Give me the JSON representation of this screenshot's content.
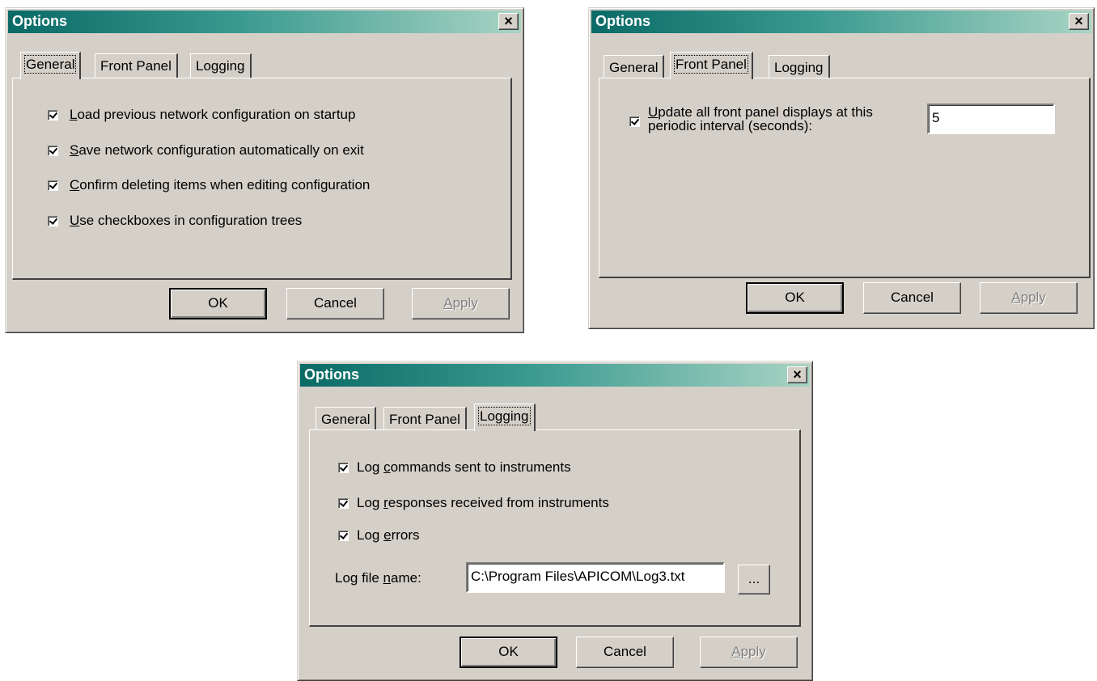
{
  "dialog1": {
    "title": "Options",
    "close": "×",
    "tabs": [
      "General",
      "Front Panel",
      "Logging"
    ],
    "checkboxes": [
      {
        "u": "L",
        "rest": "oad previous network configuration on startup"
      },
      {
        "u": "S",
        "rest": "ave network configuration automatically on exit"
      },
      {
        "u": "C",
        "rest": "onfirm deleting items when editing configuration"
      },
      {
        "u": "U",
        "rest": "se checkboxes in configuration trees"
      }
    ],
    "ok": "OK",
    "cancel": "Cancel",
    "apply_u": "A",
    "apply_rest": "pply"
  },
  "dialog2": {
    "title": "Options",
    "close": "×",
    "tabs": [
      "General",
      "Front Panel",
      "Logging"
    ],
    "update_u": "U",
    "update_line1_rest": "pdate all front panel displays at this",
    "update_line2": "periodic interval (seconds):",
    "interval_value": "5",
    "ok": "OK",
    "cancel": "Cancel",
    "apply_u": "A",
    "apply_rest": "pply"
  },
  "dialog3": {
    "title": "Options",
    "close": "×",
    "tabs": [
      "General",
      "Front Panel",
      "Logging"
    ],
    "checkboxes": [
      {
        "pre": "Log ",
        "u": "c",
        "rest": "ommands sent to instruments"
      },
      {
        "pre": "Log ",
        "u": "r",
        "rest": "esponses received from instruments"
      },
      {
        "pre": "Log ",
        "u": "e",
        "rest": "rrors"
      }
    ],
    "logfile_pre": "Log file ",
    "logfile_u": "n",
    "logfile_rest": "ame:",
    "logfile_value": "C:\\Program Files\\APICOM\\Log3.txt",
    "browse": "...",
    "ok": "OK",
    "cancel": "Cancel",
    "apply_u": "A",
    "apply_rest": "pply"
  }
}
